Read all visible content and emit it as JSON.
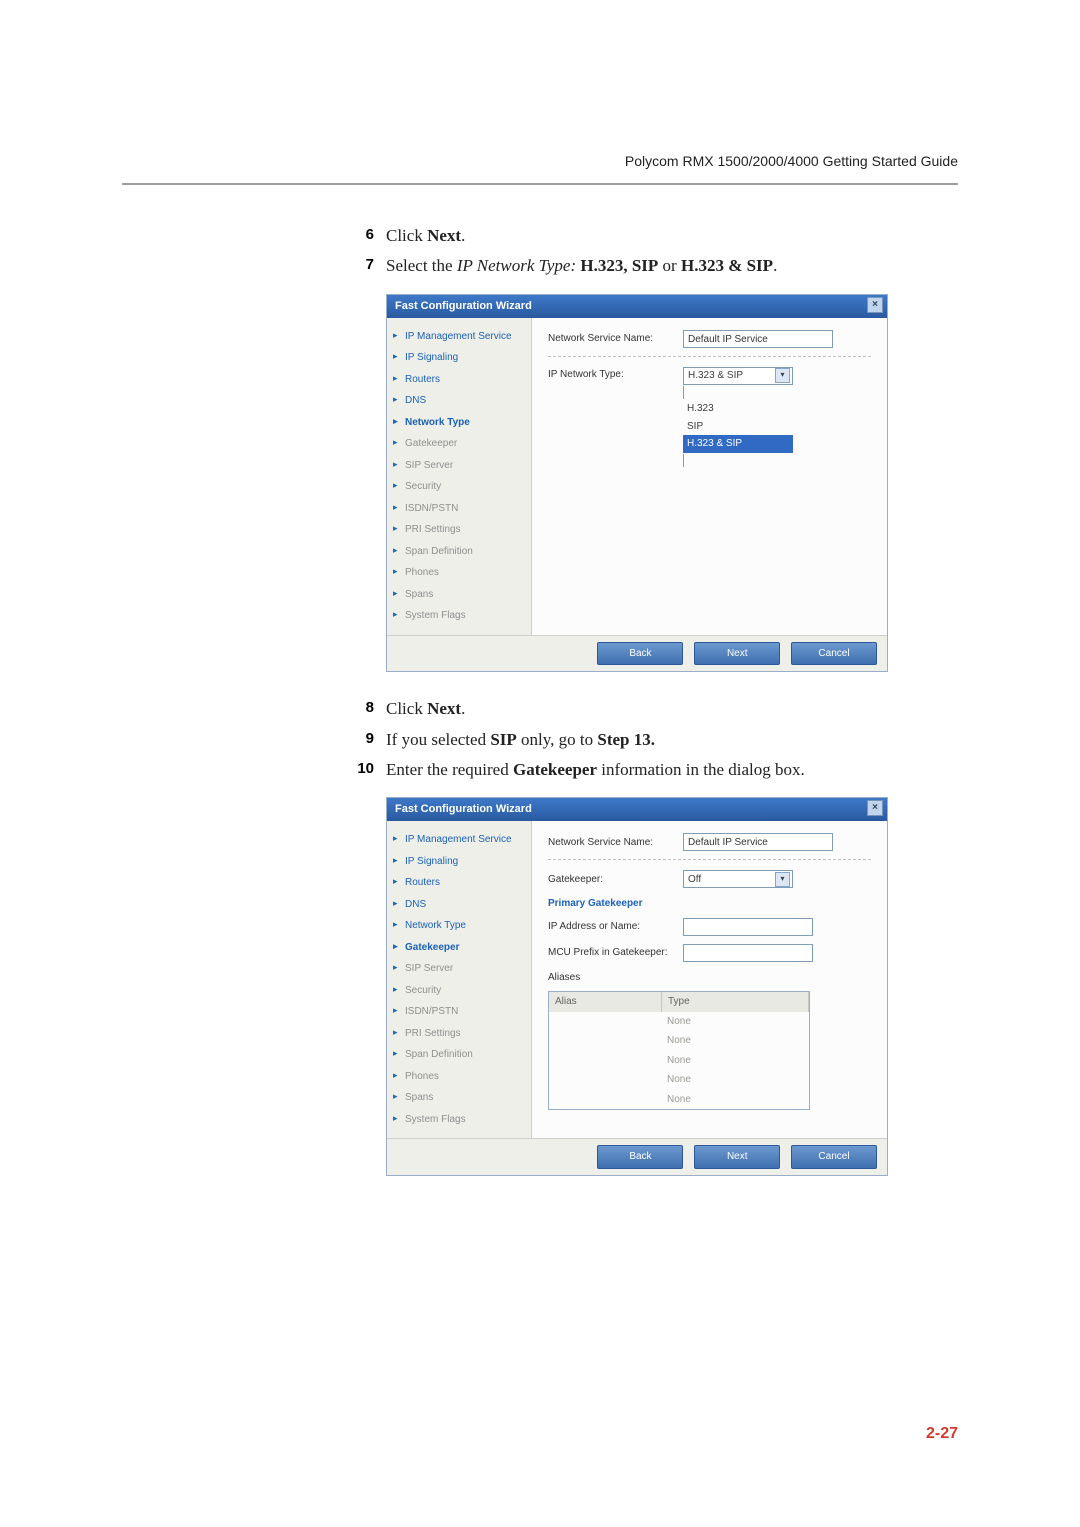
{
  "header": {
    "guide": "Polycom RMX 1500/2000/4000 Getting Started Guide"
  },
  "steps": {
    "s6": {
      "num": "6",
      "t_click": "Click ",
      "t_next": "Next",
      "t_period": "."
    },
    "s7": {
      "num": "7",
      "t1": "Select the ",
      "t_it": "IP Network Type:",
      "t_b1": " H.323, SIP",
      "t_or": " or ",
      "t_b2": "H.323 & SIP",
      "t_period": "."
    },
    "s8": {
      "num": "8",
      "t_click": "Click ",
      "t_next": "Next",
      "t_period": "."
    },
    "s9": {
      "num": "9",
      "t1": "If you selected ",
      "t_b1": "SIP",
      "t2": " only, go to ",
      "t_b2": "Step 13.",
      "t3": ""
    },
    "s10": {
      "num": "10",
      "t1": "Enter the required ",
      "t_b1": "Gatekeeper",
      "t2": " information in the dialog box."
    }
  },
  "wizard": {
    "title": "Fast Configuration Wizard",
    "btn_back": "Back",
    "btn_next": "Next",
    "btn_cancel": "Cancel",
    "nav": [
      "IP Management Service",
      "IP Signaling",
      "Routers",
      "DNS",
      "Network Type",
      "Gatekeeper",
      "SIP Server",
      "Security",
      "ISDN/PSTN",
      "PRI Settings",
      "Span Definition",
      "Phones",
      "Spans",
      "System Flags"
    ],
    "shot1": {
      "service_label": "Network Service Name:",
      "service_value": "Default IP Service",
      "type_label": "IP Network Type:",
      "type_value": "H.323 & SIP",
      "options": [
        "H.323",
        "SIP",
        "H.323 & SIP"
      ]
    },
    "shot2": {
      "service_label": "Network Service Name:",
      "service_value": "Default IP Service",
      "gk_label": "Gatekeeper:",
      "gk_value": "Off",
      "primary_heading": "Primary Gatekeeper",
      "ip_label": "IP Address or Name:",
      "ip_value": "",
      "prefix_label": "MCU Prefix in Gatekeeper:",
      "prefix_value": "",
      "aliases_heading": "Aliases",
      "col_alias": "Alias",
      "col_type": "Type",
      "none": "None"
    }
  },
  "page_number": "2-27"
}
